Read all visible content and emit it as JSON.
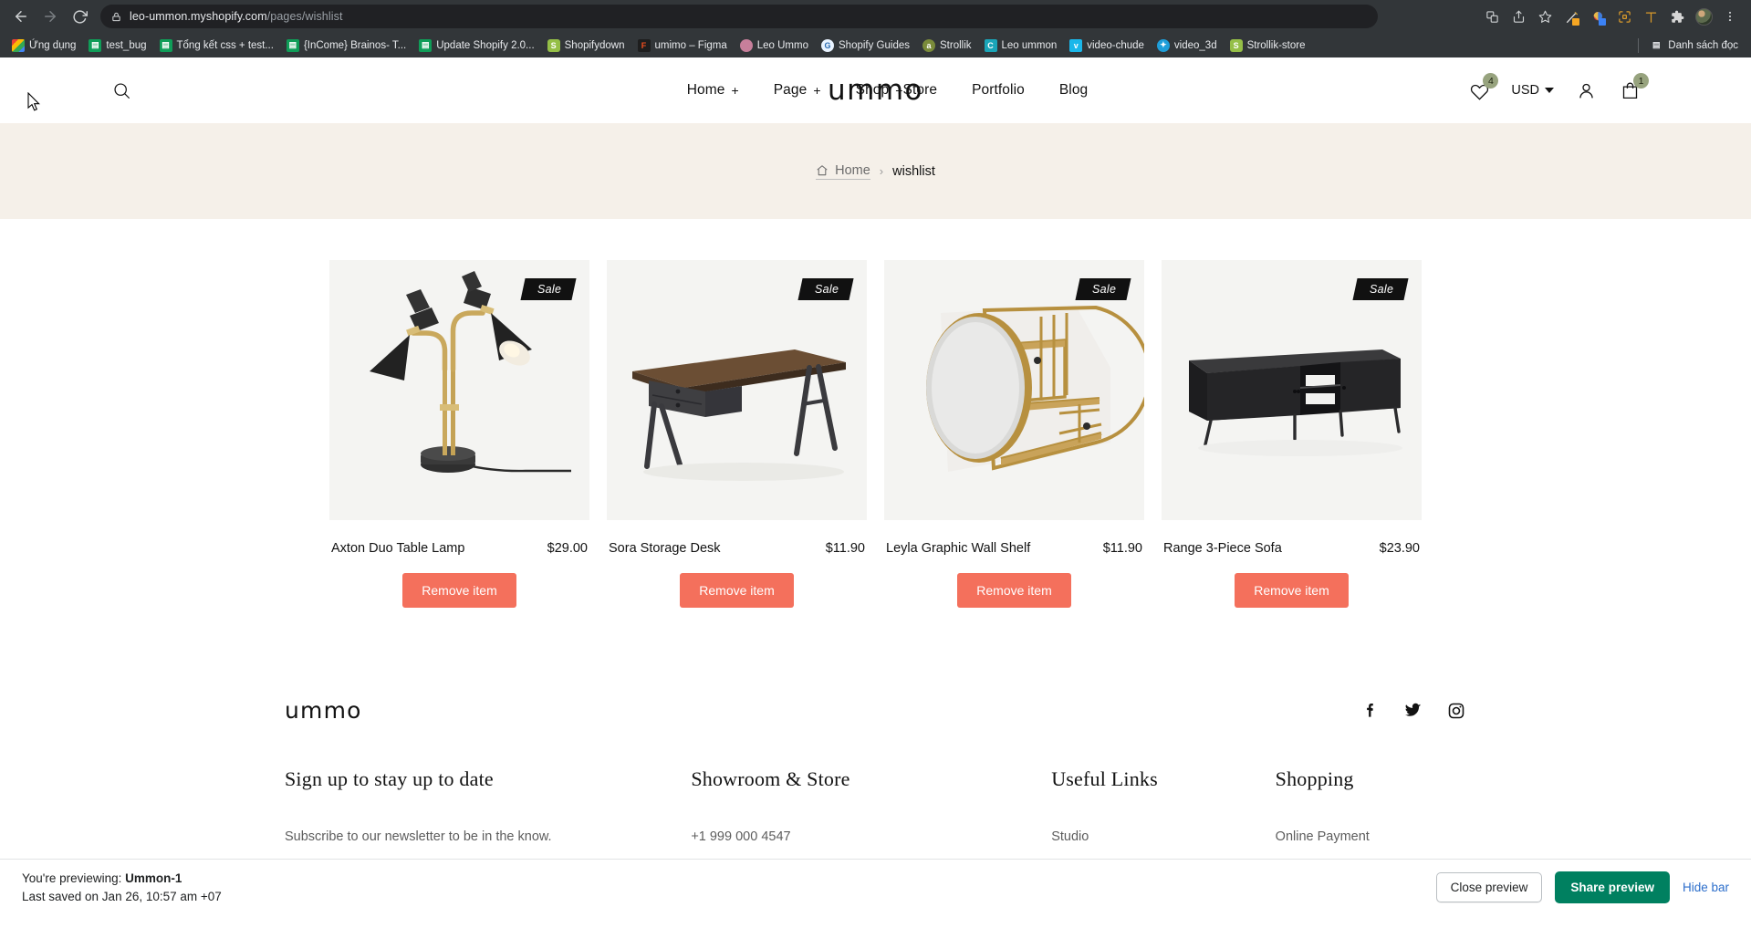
{
  "browser": {
    "url_host": "leo-ummon.myshopify.com",
    "url_path": "/pages/wishlist",
    "back_icon": "back-arrow-icon",
    "forward_icon": "forward-arrow-icon",
    "reload_icon": "reload-icon",
    "lock_icon": "lock-icon",
    "bookmarks": [
      {
        "label": "Ứng dụng",
        "fav": "apps"
      },
      {
        "label": "test_bug",
        "fav": "sheet"
      },
      {
        "label": "Tổng kết css + test...",
        "fav": "sheet"
      },
      {
        "label": "{InCome} Brainos- T...",
        "fav": "sheet"
      },
      {
        "label": "Update Shopify 2.0...",
        "fav": "sheet"
      },
      {
        "label": "Shopifydown",
        "fav": "shopify"
      },
      {
        "label": "umimo – Figma",
        "fav": "figma"
      },
      {
        "label": "Leo Ummo",
        "fav": "photo"
      },
      {
        "label": "Shopify Guides",
        "fav": "guides"
      },
      {
        "label": "Strollik",
        "fav": "olive"
      },
      {
        "label": "Leo ummon",
        "fav": "teal"
      },
      {
        "label": "video-chude",
        "fav": "vimeo"
      },
      {
        "label": "video_3d",
        "fav": "blue"
      },
      {
        "label": "Strollik-store",
        "fav": "shopify"
      }
    ],
    "reading_list": "Danh sách đọc",
    "reading_list_icon": "reading-list-icon",
    "toolbar_icons": [
      "translate-icon",
      "share-icon",
      "bookmark-star-icon",
      "extension-pencil-icon",
      "extension-colorpicker-icon",
      "extension-capture-icon",
      "extension-ruler-icon",
      "extensions-puzzle-icon",
      "profile-avatar",
      "chrome-menu-icon"
    ]
  },
  "header": {
    "search_icon": "search-icon",
    "brand": "ummo",
    "nav_left": [
      {
        "label": "Home",
        "plus": "+"
      },
      {
        "label": "Page",
        "plus": "+"
      },
      {
        "label": "Shop",
        "plus": "+"
      }
    ],
    "nav_right": [
      {
        "label": "Store"
      },
      {
        "label": "Portfolio"
      },
      {
        "label": "Blog"
      }
    ],
    "wishlist_icon": "heart-icon",
    "wishlist_count": "4",
    "currency": "USD",
    "account_icon": "user-icon",
    "cart_icon": "cart-icon",
    "cart_count": "1"
  },
  "breadcrumb": {
    "home_icon": "home-icon",
    "home": "Home",
    "separator": "›",
    "current": "wishlist"
  },
  "products": [
    {
      "name": "Axton Duo Table Lamp",
      "price": "$29.00",
      "badge": "Sale",
      "remove_label": "Remove item",
      "image": "black-brass-duo-table-lamp"
    },
    {
      "name": "Sora Storage Desk",
      "price": "$11.90",
      "badge": "Sale",
      "remove_label": "Remove item",
      "image": "walnut-desk-with-drawers"
    },
    {
      "name": "Leyla Graphic Wall Shelf",
      "price": "$11.90",
      "badge": "Sale",
      "remove_label": "Remove item",
      "image": "gold-round-mirror-wall-shelf"
    },
    {
      "name": "Range 3-Piece Sofa",
      "price": "$23.90",
      "badge": "Sale",
      "remove_label": "Remove item",
      "image": "black-media-sideboard"
    }
  ],
  "footer": {
    "brand": "ummo",
    "socials": [
      "facebook-icon",
      "twitter-icon",
      "instagram-icon"
    ],
    "columns": [
      {
        "title": "Sign up to stay up to date",
        "text": "Subscribe to our newsletter to be in the know."
      },
      {
        "title": "Showroom & Store",
        "text": "+1 999 000 4547"
      },
      {
        "title": "Useful Links",
        "text": "Studio"
      },
      {
        "title": "Shopping",
        "text": "Online Payment"
      }
    ]
  },
  "preview_bar": {
    "previewing_prefix": "You're previewing: ",
    "theme_name": "Ummon-1",
    "last_saved": "Last saved on Jan 26, 10:57 am +07",
    "close_label": "Close preview",
    "share_label": "Share preview",
    "hide_label": "Hide bar"
  },
  "colors": {
    "accent_remove": "#f4705c",
    "badge_green": "#97a37e",
    "shopify_green": "#008060",
    "link_blue": "#2c6ecb",
    "band_beige": "#f5f0e9"
  }
}
